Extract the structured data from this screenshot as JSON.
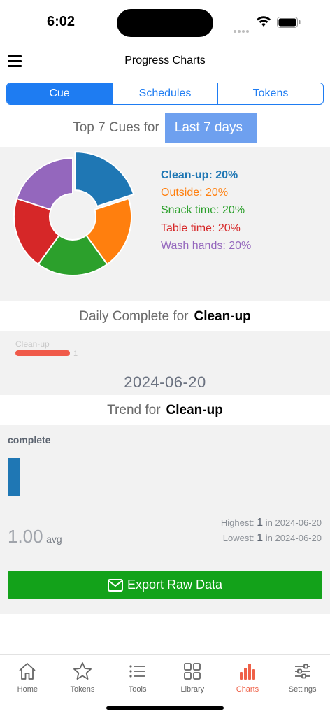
{
  "status": {
    "time": "6:02"
  },
  "nav": {
    "title": "Progress Charts"
  },
  "segments": [
    {
      "label": "Cue",
      "active": true
    },
    {
      "label": "Schedules",
      "active": false
    },
    {
      "label": "Tokens",
      "active": false
    }
  ],
  "top_cues": {
    "label": "Top 7 Cues for",
    "range": "Last 7 days"
  },
  "chart_data": [
    {
      "type": "pie",
      "categories": [
        "Clean-up",
        "Outside",
        "Snack time",
        "Table time",
        "Wash hands"
      ],
      "values": [
        20,
        20,
        20,
        20,
        20
      ],
      "legend_labels": [
        "Clean-up: 20%",
        "Outside: 20%",
        "Snack time: 20%",
        "Table time: 20%",
        "Wash hands: 20%"
      ],
      "colors": [
        "#1f77b4",
        "#ff7f0e",
        "#2ca02c",
        "#d62728",
        "#9467bd"
      ],
      "legend": "right",
      "donut": true
    },
    {
      "type": "bar",
      "orientation": "horizontal",
      "categories": [
        "Clean-up"
      ],
      "values": [
        1
      ],
      "value_labels": [
        "1"
      ],
      "colors": [
        "#f05a4a"
      ]
    },
    {
      "type": "bar",
      "categories": [
        "2024-06-20"
      ],
      "series": [
        {
          "name": "complete",
          "values": [
            1
          ]
        }
      ],
      "colors": [
        "#1f77b4"
      ]
    }
  ],
  "daily": {
    "label": "Daily Complete for",
    "cue": "Clean-up",
    "date": "2024-06-20"
  },
  "trend": {
    "label": "Trend for",
    "cue": "Clean-up",
    "metric": "complete",
    "avg_value": "1.00",
    "avg_unit": "avg",
    "highest_label": "Highest:",
    "highest_value": "1",
    "highest_in": "in 2024-06-20",
    "lowest_label": "Lowest:",
    "lowest_value": "1",
    "lowest_in": "in 2024-06-20"
  },
  "export": {
    "label": "Export Raw Data"
  },
  "tabs": [
    {
      "label": "Home",
      "icon": "house-icon"
    },
    {
      "label": "Tokens",
      "icon": "star-icon"
    },
    {
      "label": "Tools",
      "icon": "list-icon"
    },
    {
      "label": "Library",
      "icon": "grid-icon"
    },
    {
      "label": "Charts",
      "icon": "bar-chart-icon",
      "active": true
    },
    {
      "label": "Settings",
      "icon": "sliders-icon"
    }
  ],
  "colors": {
    "accent": "#1e7cf2",
    "range_button": "#6ea0ef",
    "export": "#13a21a",
    "active_tab": "#ef6148"
  }
}
